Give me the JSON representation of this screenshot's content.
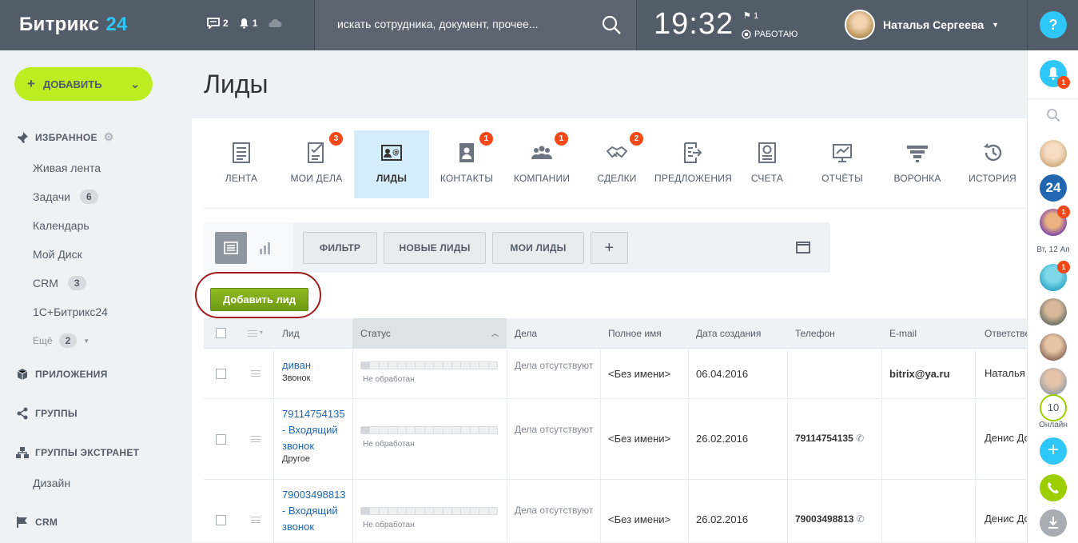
{
  "header": {
    "logo_text": "Битрикс",
    "logo_num": "24",
    "messages_count": "2",
    "notifications_count": "1",
    "search_placeholder": "искать сотрудника, документ, прочее...",
    "time": "19:32",
    "flag_count": "1",
    "work_status": "РАБОТАЮ",
    "user_name": "Наталья Сергеева",
    "help": "?"
  },
  "sidebar": {
    "add_label": "ДОБАВИТЬ",
    "favorites": "ИЗБРАННОЕ",
    "items": [
      {
        "label": "Живая лента",
        "count": ""
      },
      {
        "label": "Задачи",
        "count": "6"
      },
      {
        "label": "Календарь",
        "count": ""
      },
      {
        "label": "Мой Диск",
        "count": ""
      },
      {
        "label": "CRM",
        "count": "3"
      },
      {
        "label": "1С+Битрикс24",
        "count": ""
      },
      {
        "label": "Ещё",
        "count": "2"
      }
    ],
    "apps": "ПРИЛОЖЕНИЯ",
    "groups": "ГРУППЫ",
    "extranet": "ГРУППЫ ЭКСТРАНЕТ",
    "design": "Дизайн",
    "crm": "CRM"
  },
  "page": {
    "title": "Лиды"
  },
  "tabs": [
    {
      "label": "ЛЕНТА",
      "badge": "",
      "icon": "feed-icon"
    },
    {
      "label": "МОИ ДЕЛА",
      "badge": "3",
      "icon": "tasks-icon"
    },
    {
      "label": "ЛИДЫ",
      "badge": "",
      "icon": "leads-icon"
    },
    {
      "label": "КОНТАКТЫ",
      "badge": "1",
      "icon": "contacts-icon"
    },
    {
      "label": "КОМПАНИИ",
      "badge": "1",
      "icon": "companies-icon"
    },
    {
      "label": "СДЕЛКИ",
      "badge": "2",
      "icon": "deals-icon"
    },
    {
      "label": "ПРЕДЛОЖЕНИЯ",
      "badge": "",
      "icon": "quotes-icon"
    },
    {
      "label": "СЧЕТА",
      "badge": "",
      "icon": "invoices-icon"
    },
    {
      "label": "ОТЧЁТЫ",
      "badge": "",
      "icon": "reports-icon"
    },
    {
      "label": "ВОРОНКА",
      "badge": "",
      "icon": "funnel-icon"
    },
    {
      "label": "ИСТОРИЯ",
      "badge": "",
      "icon": "history-icon"
    }
  ],
  "filters": {
    "filter": "ФИЛЬТР",
    "new_leads": "НОВЫЕ ЛИДЫ",
    "my_leads": "МОИ ЛИДЫ",
    "plus": "+"
  },
  "add_lead": "Добавить лид",
  "grid": {
    "columns": [
      "Лид",
      "Статус",
      "Дела",
      "Полное имя",
      "Дата создания",
      "Телефон",
      "E-mail",
      "Ответственный"
    ],
    "rows": [
      {
        "lead": "диван",
        "source": "Звонок",
        "status": "Не обработан",
        "deals": "Дела отсутствуют",
        "name": "<Без имени>",
        "date": "06.04.2016",
        "phone": "",
        "email": "bitrix@ya.ru",
        "resp": "Наталья Се"
      },
      {
        "lead_l1": "79114754135",
        "lead_l2": "- Входящий",
        "lead_l3": "звонок",
        "source": "Другое",
        "status": "Не обработан",
        "deals": "Дела отсутствуют",
        "name": "<Без имени>",
        "date": "26.02.2016",
        "phone": "79114754135",
        "email": "",
        "resp": "Денис Дом"
      },
      {
        "lead_l1": "79003498813",
        "lead_l2": "- Входящий",
        "lead_l3": "звонок",
        "source": "",
        "status": "Не обработан",
        "deals": "Дела отсутствуют",
        "name": "<Без имени>",
        "date": "26.02.2016",
        "phone": "79003498813",
        "email": "",
        "resp": "Денис Дом"
      }
    ]
  },
  "rightbar": {
    "notif_badge": "1",
    "date": "Вт, 12 Ап",
    "badge2": "1",
    "badge3": "1",
    "online_count": "10",
    "online_label": "Онлайн"
  },
  "colors": {
    "topbar": "#535c69",
    "accent": "#2fc7f7",
    "add_button": "#bbed21",
    "link": "#2067b0",
    "badge": "#f54819",
    "active_tab": "#d4edfa"
  }
}
